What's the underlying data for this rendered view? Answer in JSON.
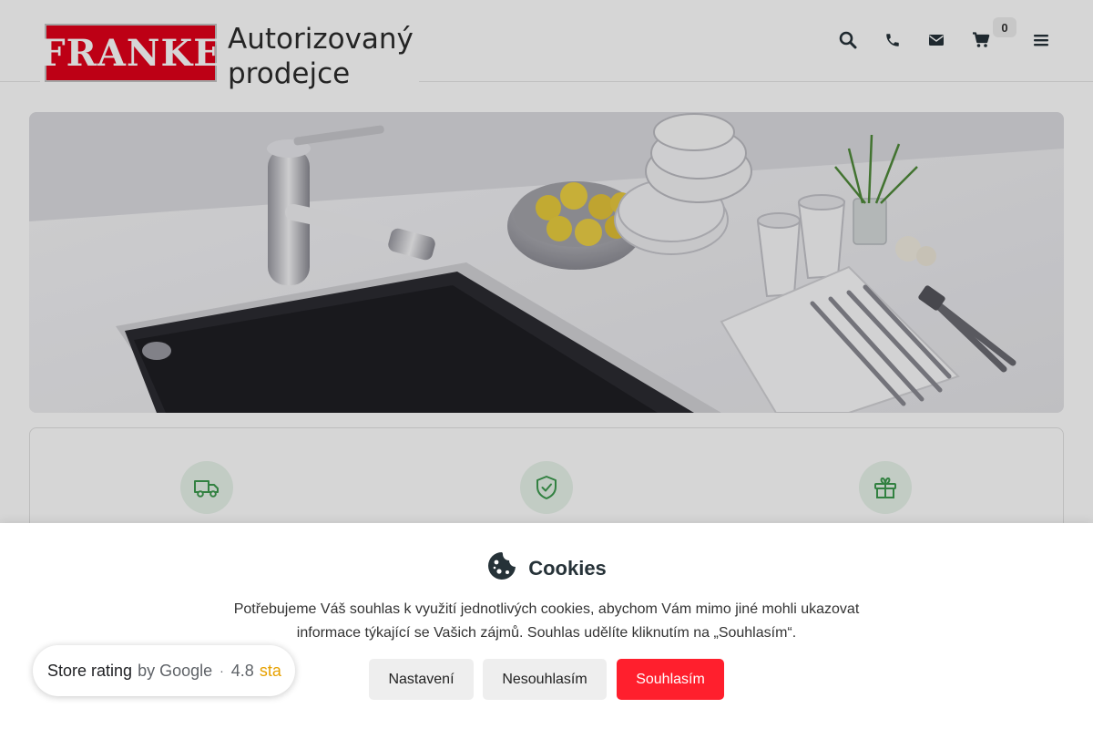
{
  "header": {
    "logo": {
      "brand": "FRANKE",
      "line1": "Autorizovaný",
      "line2": "prodejce"
    },
    "icons": [
      "search-icon",
      "phone-icon",
      "mail-icon",
      "cart-icon",
      "menu-icon"
    ],
    "cart_count": "0"
  },
  "hero": {
    "image": "kitchen-sink-hero"
  },
  "features": {
    "icons": [
      "truck-icon",
      "shield-check-icon",
      "gift-icon"
    ],
    "icon_color": "#3c9a4e"
  },
  "cookie_banner": {
    "title": "Cookies",
    "text_line1": "Potřebujeme Váš souhlas k využití jednotlivých cookies, abychom Vám mimo jiné mohli ukazovat",
    "text_line2": "informace týkající se Vašich zájmů. Souhlas udělíte kliknutím na „Souhlasím“.",
    "buttons": {
      "settings": "Nastavení",
      "decline": "Nesouhlasím",
      "accept": "Souhlasím"
    },
    "accept_color": "#ff1f2d"
  },
  "store_rating": {
    "title": "Store rating",
    "by": "by Google",
    "dot": "·",
    "score": "4.8",
    "stars_text": "sta"
  },
  "colors": {
    "brand": "#e2001a",
    "accent_green": "#3c9a4e"
  }
}
